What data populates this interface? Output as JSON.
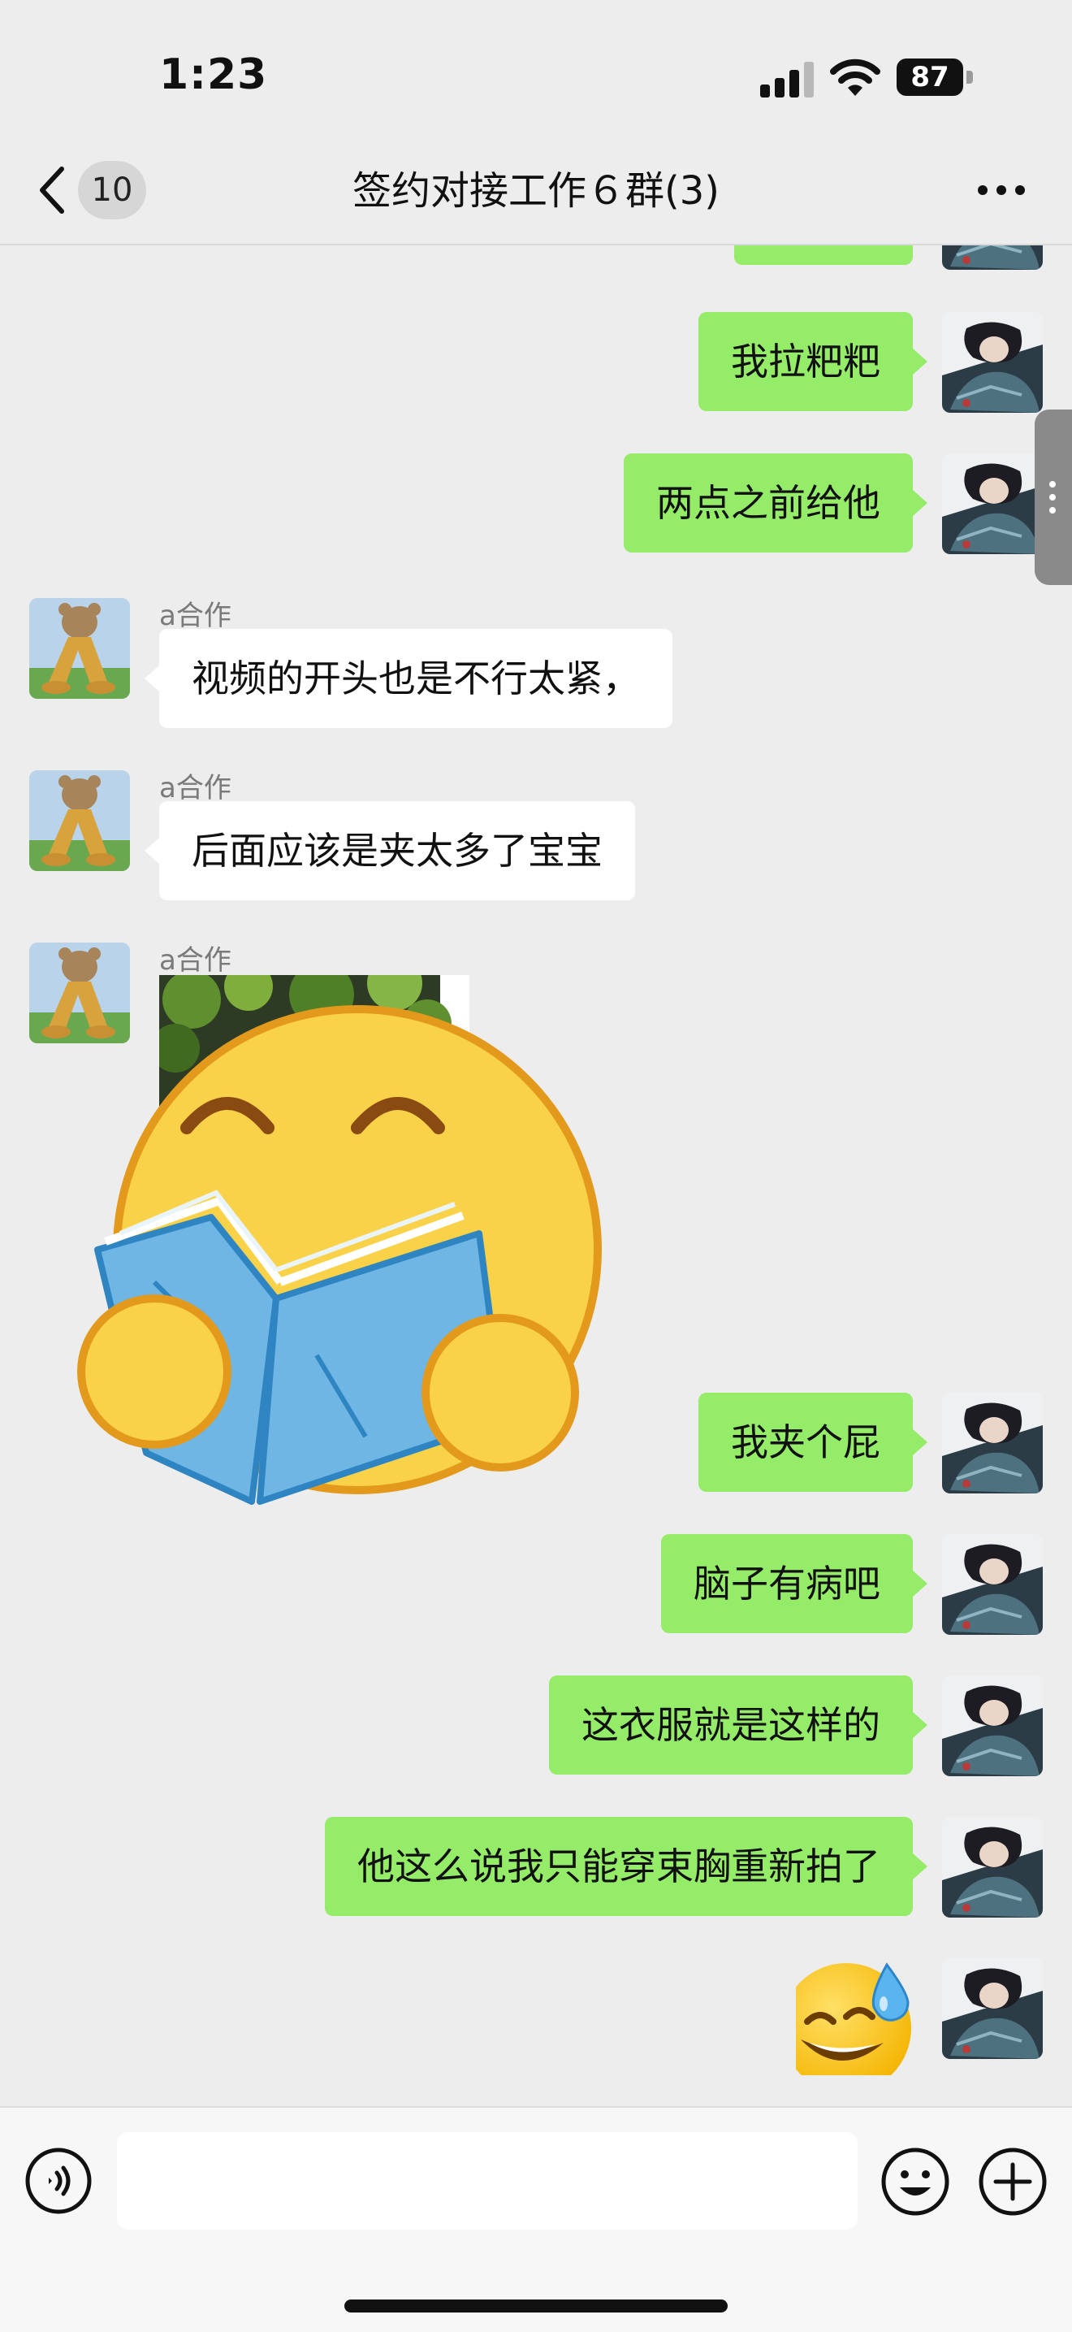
{
  "status_bar": {
    "time": "1:23",
    "battery": "87"
  },
  "nav": {
    "back_badge": "10",
    "title": "签约对接工作６群(3)"
  },
  "messages": [
    {
      "text": "我拉粑粑"
    },
    {
      "text": "两点之前给他"
    },
    {
      "sender": "a合作",
      "text": "视频的开头也是不行太紧，"
    },
    {
      "sender": "a合作",
      "text": "后面应该是夹太多了宝宝"
    },
    {
      "sender": "a合作"
    },
    {
      "text": "我夹个屁"
    },
    {
      "text": "脑子有病吧"
    },
    {
      "text": "这衣服就是这样的"
    },
    {
      "text": "他这么说我只能穿束胸重新拍了"
    }
  ],
  "icons": {
    "back": "chevron-left-icon",
    "more": "ellipsis-icon",
    "voice": "voice-icon",
    "emoji": "smile-icon",
    "plus": "plus-icon",
    "sticker": "reading-emoji-sticker",
    "small_sticker": "sweat-smile-emoji-sticker"
  },
  "colors": {
    "outgoing_bubble": "#95ec69",
    "incoming_bubble": "#ffffff",
    "background": "#ededed"
  }
}
